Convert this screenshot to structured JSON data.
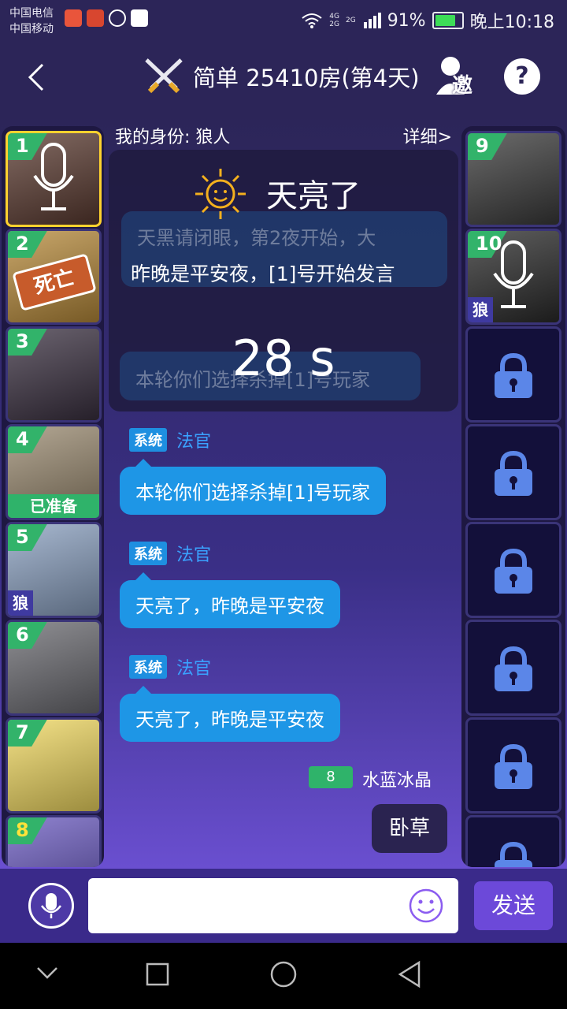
{
  "status_bar": {
    "carrier_1": "中国电信",
    "carrier_2": "中国移动",
    "network_1": "4G",
    "network_2": "2G",
    "network_3": "2G",
    "battery": "91%",
    "battery_level": 0.91,
    "time": "晚上10:18",
    "app_icon_colors": [
      "#e9553b",
      "#d8462f",
      "#ffffff",
      "#e23b3b"
    ]
  },
  "header": {
    "back_icon": "chevron-left-icon",
    "room_icon": "crossed-swords-icon",
    "title": "简单 25410房(第4天)",
    "invite_icon": "invite-user-icon",
    "invite_label": "邀",
    "help_label": "?"
  },
  "identity": {
    "label": "我的身份: 狼人",
    "details_link": "详细>"
  },
  "seats_left": [
    {
      "number": "1",
      "state": "speaking",
      "selected": true
    },
    {
      "number": "2",
      "state": "dead",
      "tag": "死亡"
    },
    {
      "number": "3",
      "state": "normal"
    },
    {
      "number": "4",
      "state": "ready",
      "tag": "已准备"
    },
    {
      "number": "5",
      "state": "wolf",
      "tag": "狼"
    },
    {
      "number": "6",
      "state": "normal"
    },
    {
      "number": "7",
      "state": "normal"
    },
    {
      "number": "8",
      "state": "normal"
    }
  ],
  "seats_right": [
    {
      "number": "9",
      "state": "normal"
    },
    {
      "number": "10",
      "state": "speaking",
      "tag": "狼"
    },
    {
      "number": "",
      "state": "locked"
    },
    {
      "number": "",
      "state": "locked"
    },
    {
      "number": "",
      "state": "locked"
    },
    {
      "number": "",
      "state": "locked"
    },
    {
      "number": "",
      "state": "locked"
    },
    {
      "number": "",
      "state": "locked"
    }
  ],
  "overlay": {
    "icon": "sun-icon",
    "title": "天亮了",
    "message": "昨晚是平安夜，[1]号开始发言",
    "timer": "28 s",
    "ghost_lines": [
      "天黑请闭眼，第2夜开始，大",
      "本轮你们选择杀掉[1]号玩家"
    ]
  },
  "chat": {
    "system_badge": "系统",
    "sender": "法官",
    "messages": [
      "本轮你们选择杀掉[1]号玩家",
      "天亮了，昨晚是平安夜",
      "天亮了，昨晚是平安夜"
    ],
    "user_message": {
      "seat": "8",
      "name": "水蓝冰晶",
      "text": "卧草"
    }
  },
  "input_bar": {
    "mic_icon": "microphone-icon",
    "placeholder": "",
    "emoji_icon": "smile-icon",
    "send_label": "发送"
  },
  "nav_bar": {
    "icons": [
      "chevron-down-icon",
      "square-icon",
      "circle-icon",
      "triangle-back-icon"
    ]
  }
}
